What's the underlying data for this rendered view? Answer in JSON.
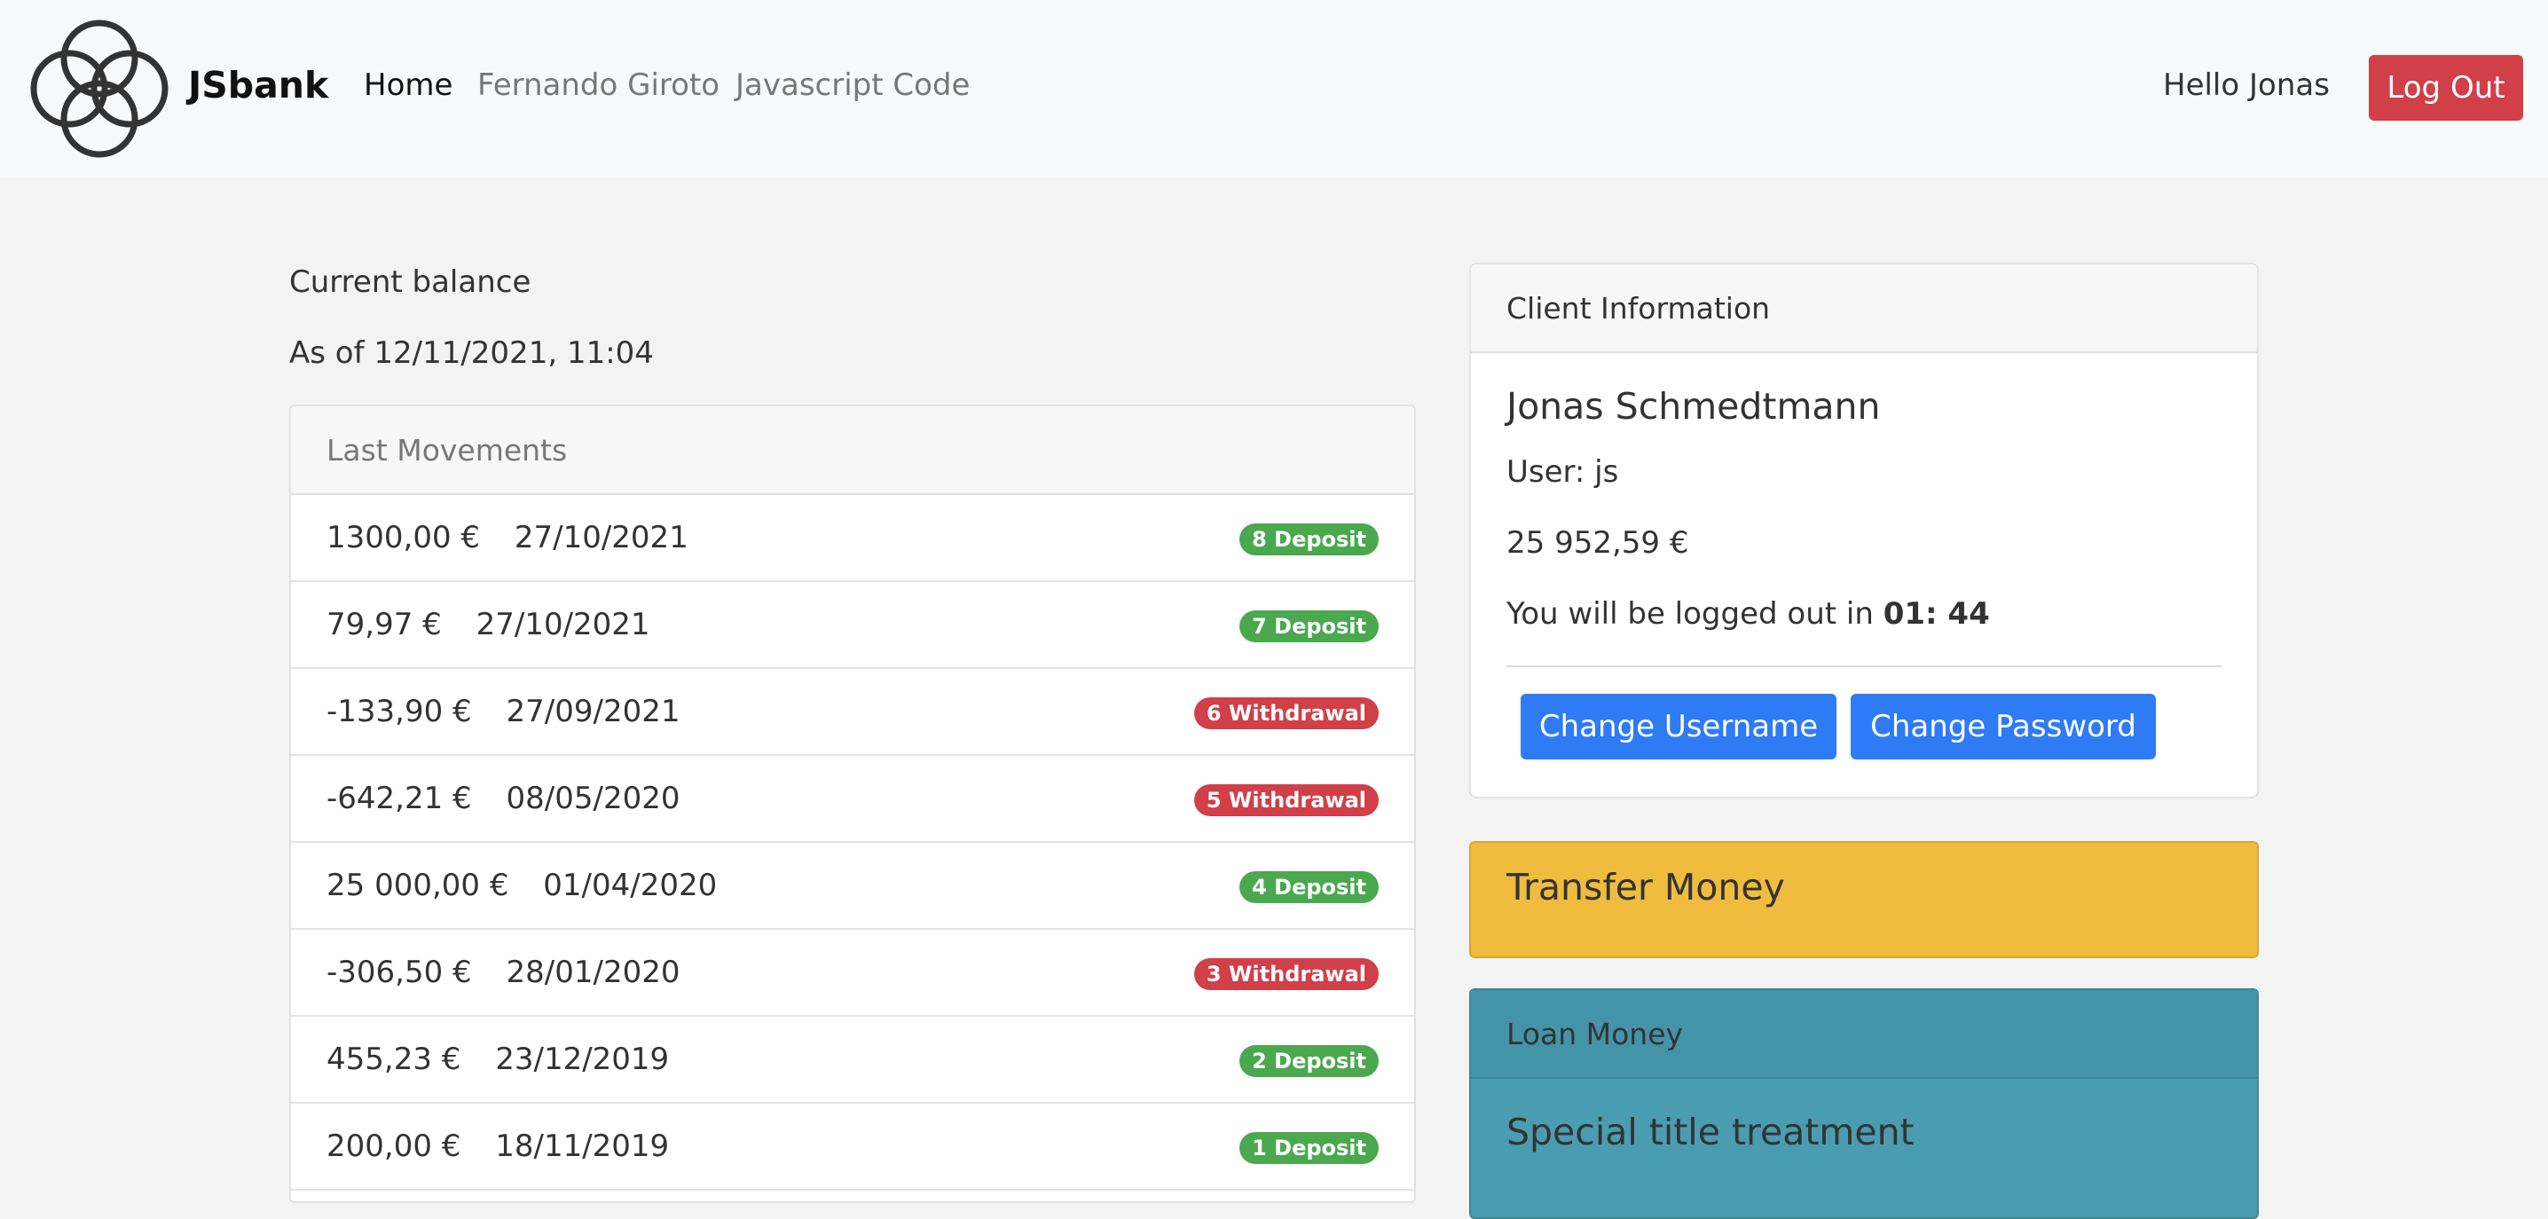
{
  "navbar": {
    "brand": "JSbank",
    "links": [
      {
        "label": "Home",
        "active": true
      },
      {
        "label": "Fernando Giroto",
        "active": false
      },
      {
        "label": "Javascript Code",
        "active": false
      }
    ],
    "greeting": "Hello Jonas",
    "logout_label": "Log Out"
  },
  "balance": {
    "label": "Current balance",
    "as_of": "As of 12/11/2021, 11:04"
  },
  "movements": {
    "header": "Last Movements",
    "rows": [
      {
        "amount": "1300,00 €",
        "date": "27/10/2021",
        "badge": "8 Deposit",
        "type": "deposit"
      },
      {
        "amount": "79,97 €",
        "date": "27/10/2021",
        "badge": "7 Deposit",
        "type": "deposit"
      },
      {
        "amount": "-133,90 €",
        "date": "27/09/2021",
        "badge": "6 Withdrawal",
        "type": "withdrawal"
      },
      {
        "amount": "-642,21 €",
        "date": "08/05/2020",
        "badge": "5 Withdrawal",
        "type": "withdrawal"
      },
      {
        "amount": "25 000,00 €",
        "date": "01/04/2020",
        "badge": "4 Deposit",
        "type": "deposit"
      },
      {
        "amount": "-306,50 €",
        "date": "28/01/2020",
        "badge": "3 Withdrawal",
        "type": "withdrawal"
      },
      {
        "amount": "455,23 €",
        "date": "23/12/2019",
        "badge": "2 Deposit",
        "type": "deposit"
      },
      {
        "amount": "200,00 €",
        "date": "18/11/2019",
        "badge": "1 Deposit",
        "type": "deposit"
      }
    ]
  },
  "client": {
    "header": "Client Information",
    "name": "Jonas Schmedtmann",
    "user": "User: js",
    "balance": "25 952,59 €",
    "timer_prefix": "You will be logged out in ",
    "timer_value": "01: 44",
    "change_username_label": "Change Username",
    "change_password_label": "Change Password"
  },
  "transfer": {
    "title": "Transfer Money"
  },
  "loan": {
    "header": "Loan Money",
    "title": "Special title treatment"
  },
  "colors": {
    "danger": "#d13f48",
    "success": "#4aa84f",
    "primary": "#2f7bf6",
    "warning": "#f0bc3e",
    "info": "#4a9db0"
  }
}
